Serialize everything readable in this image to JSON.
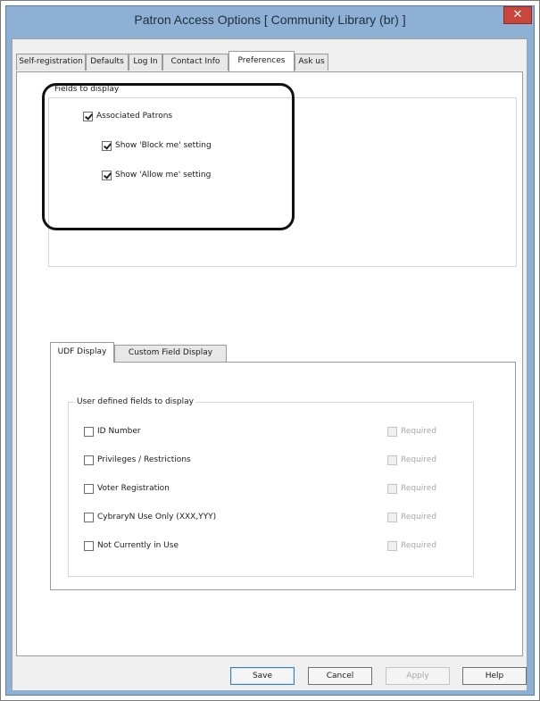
{
  "window": {
    "title": "Patron Access Options [ Community Library  (br) ]",
    "close_glyph": "✕"
  },
  "tabs": [
    {
      "label": "Self-registration",
      "active": false
    },
    {
      "label": "Defaults",
      "active": false
    },
    {
      "label": "Log In",
      "active": false
    },
    {
      "label": "Contact Info",
      "active": false
    },
    {
      "label": "Preferences",
      "active": true
    },
    {
      "label": "Ask us",
      "active": false
    }
  ],
  "fields_to_display": {
    "legend": "Fields to display",
    "associated_patrons": {
      "label": "Associated Patrons",
      "checked": true
    },
    "show_block_me": {
      "label": "Show 'Block me' setting",
      "checked": true
    },
    "show_allow_me": {
      "label": "Show 'Allow me' setting",
      "checked": true
    }
  },
  "sub_tabs": [
    {
      "label": "UDF Display",
      "active": true
    },
    {
      "label": "Custom Field Display",
      "active": false
    }
  ],
  "udf": {
    "legend": "User defined fields to display",
    "fields": [
      {
        "label": "ID Number",
        "checked": false,
        "required_label": "Required",
        "required_checked": false
      },
      {
        "label": "Privileges / Restrictions",
        "checked": false,
        "required_label": "Required",
        "required_checked": false
      },
      {
        "label": "Voter Registration",
        "checked": false,
        "required_label": "Required",
        "required_checked": false
      },
      {
        "label": "CybraryN Use Only (XXX,YYY)",
        "checked": false,
        "required_label": "Required",
        "required_checked": false
      },
      {
        "label": "Not Currently in Use",
        "checked": false,
        "required_label": "Required",
        "required_checked": false
      }
    ]
  },
  "buttons": {
    "save": "Save",
    "cancel": "Cancel",
    "apply": "Apply",
    "help": "Help"
  },
  "colors": {
    "title_bar": "#8db0d4",
    "close_button": "#c9463d",
    "dialog_face": "#f0f0f0"
  }
}
